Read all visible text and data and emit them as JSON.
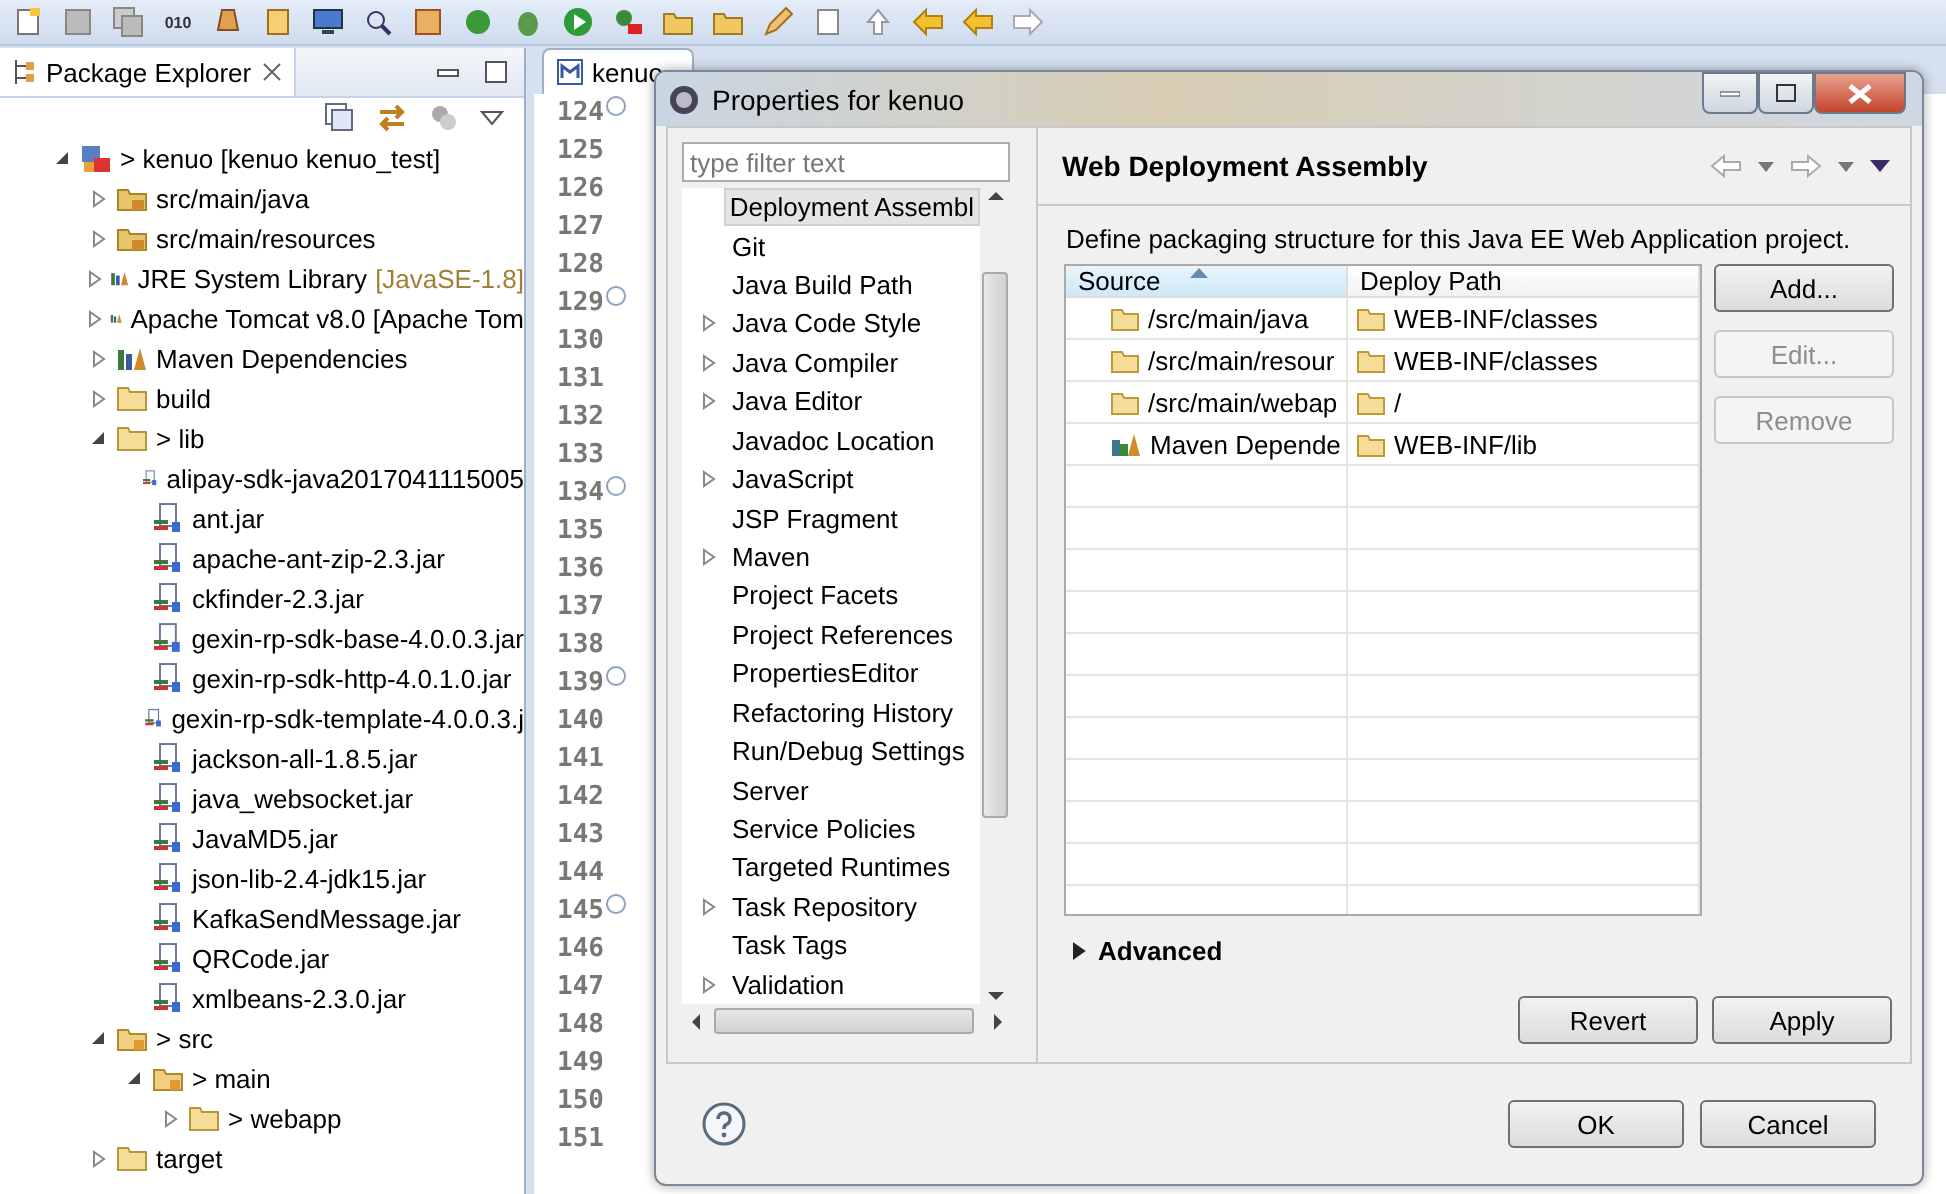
{
  "toolbar": [
    {
      "kind": "new"
    },
    {
      "kind": "save"
    },
    {
      "kind": "saveall"
    },
    {
      "kind": "binary",
      "label": "010"
    },
    {
      "kind": "lamp"
    },
    {
      "kind": "server"
    },
    {
      "kind": "monitor"
    },
    {
      "kind": "search"
    },
    {
      "kind": "grid"
    },
    {
      "kind": "refresh"
    },
    {
      "kind": "bug"
    },
    {
      "kind": "run"
    },
    {
      "kind": "tool"
    },
    {
      "kind": "folder"
    },
    {
      "kind": "folder"
    },
    {
      "kind": "pen"
    },
    {
      "kind": "doc"
    },
    {
      "kind": "up"
    },
    {
      "kind": "back"
    },
    {
      "kind": "back"
    },
    {
      "kind": "forward"
    }
  ],
  "package_explorer": {
    "title": "Package Explorer",
    "tree": [
      {
        "label": "> kenuo [kenuo kenuo_test]",
        "kind": "project",
        "expanded": true,
        "children": [
          {
            "label": "src/main/java",
            "kind": "source",
            "expanded": false
          },
          {
            "label": "src/main/resources",
            "kind": "source",
            "expanded": false
          },
          {
            "label": "JRE System Library",
            "decoration": "[JavaSE-1.8]",
            "kind": "library",
            "expanded": false
          },
          {
            "label": "Apache Tomcat v8.0 [Apache Tom",
            "kind": "library",
            "expanded": false
          },
          {
            "label": "Maven Dependencies",
            "kind": "library",
            "expanded": false
          },
          {
            "label": "build",
            "kind": "folder",
            "expanded": false
          },
          {
            "label": "> lib",
            "kind": "folder",
            "expanded": true,
            "children": [
              {
                "label": "alipay-sdk-java2017041115005",
                "kind": "jar"
              },
              {
                "label": "ant.jar",
                "kind": "jar"
              },
              {
                "label": "apache-ant-zip-2.3.jar",
                "kind": "jar"
              },
              {
                "label": "ckfinder-2.3.jar",
                "kind": "jar"
              },
              {
                "label": "gexin-rp-sdk-base-4.0.0.3.jar",
                "kind": "jar"
              },
              {
                "label": "gexin-rp-sdk-http-4.0.1.0.jar",
                "kind": "jar"
              },
              {
                "label": "gexin-rp-sdk-template-4.0.0.3.j",
                "kind": "jar"
              },
              {
                "label": "jackson-all-1.8.5.jar",
                "kind": "jar"
              },
              {
                "label": "java_websocket.jar",
                "kind": "jar"
              },
              {
                "label": "JavaMD5.jar",
                "kind": "jar"
              },
              {
                "label": "json-lib-2.4-jdk15.jar",
                "kind": "jar"
              },
              {
                "label": "KafkaSendMessage.jar",
                "kind": "jar"
              },
              {
                "label": "QRCode.jar",
                "kind": "jar"
              },
              {
                "label": "xmlbeans-2.3.0.jar",
                "kind": "jar"
              }
            ]
          },
          {
            "label": "> src",
            "kind": "package",
            "expanded": true,
            "children": [
              {
                "label": "> main",
                "kind": "package",
                "expanded": true,
                "children": [
                  {
                    "label": "> webapp",
                    "kind": "folder",
                    "expanded": false
                  }
                ]
              }
            ]
          },
          {
            "label": "target",
            "kind": "folder",
            "expanded": false
          }
        ]
      }
    ]
  },
  "editor": {
    "tab": "kenuo",
    "lines": [
      {
        "number": "124",
        "fold": true
      },
      {
        "number": "125",
        "fold": false
      },
      {
        "number": "126",
        "fold": false
      },
      {
        "number": "127",
        "fold": false
      },
      {
        "number": "128",
        "fold": false
      },
      {
        "number": "129",
        "fold": true
      },
      {
        "number": "130",
        "fold": false
      },
      {
        "number": "131",
        "fold": false
      },
      {
        "number": "132",
        "fold": false
      },
      {
        "number": "133",
        "fold": false
      },
      {
        "number": "134",
        "fold": true
      },
      {
        "number": "135",
        "fold": false
      },
      {
        "number": "136",
        "fold": false
      },
      {
        "number": "137",
        "fold": false
      },
      {
        "number": "138",
        "fold": false
      },
      {
        "number": "139",
        "fold": true
      },
      {
        "number": "140",
        "fold": false
      },
      {
        "number": "141",
        "fold": false
      },
      {
        "number": "142",
        "fold": false
      },
      {
        "number": "143",
        "fold": false
      },
      {
        "number": "144",
        "fold": false
      },
      {
        "number": "145",
        "fold": true
      },
      {
        "number": "146",
        "fold": false
      },
      {
        "number": "147",
        "fold": false
      },
      {
        "number": "148",
        "fold": false
      },
      {
        "number": "149",
        "fold": false
      },
      {
        "number": "150",
        "fold": false
      },
      {
        "number": "151",
        "fold": false
      }
    ]
  },
  "dialog": {
    "title": "Properties for kenuo",
    "filter": {
      "placeholder": "type filter text"
    },
    "nav": [
      {
        "label": "Deployment Assembl",
        "selected": true
      },
      {
        "label": "Git",
        "selected": false
      },
      {
        "label": "Java Build Path",
        "selected": false
      },
      {
        "label": "Java Code Style",
        "selected": false,
        "expanded": false
      },
      {
        "label": "Java Compiler",
        "selected": false,
        "expanded": false
      },
      {
        "label": "Java Editor",
        "selected": false,
        "expanded": false
      },
      {
        "label": "Javadoc Location",
        "selected": false
      },
      {
        "label": "JavaScript",
        "selected": false,
        "expanded": false
      },
      {
        "label": "JSP Fragment",
        "selected": false
      },
      {
        "label": "Maven",
        "selected": false,
        "expanded": false
      },
      {
        "label": "Project Facets",
        "selected": false
      },
      {
        "label": "Project References",
        "selected": false
      },
      {
        "label": "PropertiesEditor",
        "selected": false
      },
      {
        "label": "Refactoring History",
        "selected": false
      },
      {
        "label": "Run/Debug Settings",
        "selected": false
      },
      {
        "label": "Server",
        "selected": false
      },
      {
        "label": "Service Policies",
        "selected": false
      },
      {
        "label": "Targeted Runtimes",
        "selected": false
      },
      {
        "label": "Task Repository",
        "selected": false,
        "expanded": false
      },
      {
        "label": "Task Tags",
        "selected": false
      },
      {
        "label": "Validation",
        "selected": false,
        "expanded": false
      }
    ],
    "page_title": "Web Deployment Assembly",
    "description": "Define packaging structure for this Java EE Web Application project.",
    "table": {
      "columns": [
        "Source",
        "Deploy Path"
      ],
      "rows": [
        {
          "source": "/src/main/java",
          "kind": "folder",
          "deploy_path": "WEB-INF/classes"
        },
        {
          "source": "/src/main/resour",
          "kind": "folder",
          "deploy_path": "WEB-INF/classes"
        },
        {
          "source": "/src/main/webap",
          "kind": "folder",
          "deploy_path": "/"
        },
        {
          "source": "Maven Depende",
          "kind": "library",
          "deploy_path": "WEB-INF/lib"
        }
      ]
    },
    "side_buttons": [
      {
        "label": "Add...",
        "disabled": false
      },
      {
        "label": "Edit...",
        "disabled": true
      },
      {
        "label": "Remove",
        "disabled": true
      }
    ],
    "advanced": {
      "label": "Advanced",
      "expanded": false
    },
    "page_buttons": [
      {
        "label": "Revert"
      },
      {
        "label": "Apply"
      }
    ],
    "footer_buttons": [
      {
        "label": "OK"
      },
      {
        "label": "Cancel"
      }
    ]
  }
}
